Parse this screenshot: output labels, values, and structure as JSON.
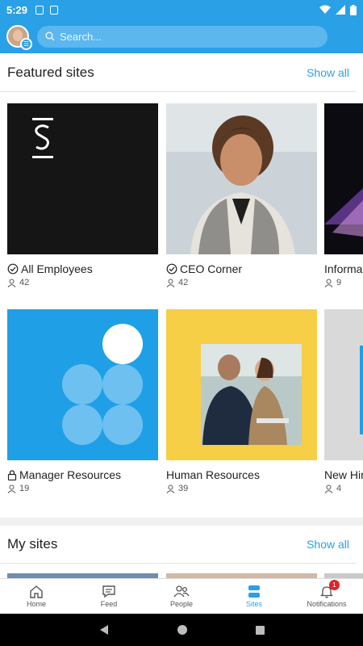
{
  "status_bar": {
    "time": "5:29"
  },
  "header": {
    "search_placeholder": "Search..."
  },
  "featured": {
    "title": "Featured sites",
    "show_all": "Show all",
    "sites": [
      {
        "name": "All Employees",
        "members": "42",
        "icon": "check-circle-icon"
      },
      {
        "name": "CEO Corner",
        "members": "42",
        "icon": "check-circle-icon"
      },
      {
        "name": "Informat",
        "members": "9",
        "icon": ""
      },
      {
        "name": "Manager Resources",
        "members": "19",
        "icon": "lock-icon"
      },
      {
        "name": "Human Resources",
        "members": "39",
        "icon": ""
      },
      {
        "name": "New Hir",
        "members": "4",
        "icon": ""
      }
    ]
  },
  "my_sites": {
    "title": "My sites",
    "show_all": "Show all"
  },
  "bottom_nav": {
    "items": [
      {
        "label": "Home",
        "icon": "home-icon"
      },
      {
        "label": "Feed",
        "icon": "feed-icon"
      },
      {
        "label": "People",
        "icon": "people-icon"
      },
      {
        "label": "Sites",
        "icon": "sites-icon"
      },
      {
        "label": "Notifications",
        "icon": "bell-icon"
      }
    ],
    "active": "Sites",
    "notification_count": "1"
  },
  "colors": {
    "accent": "#2aa0e6",
    "badge": "#e02424"
  }
}
